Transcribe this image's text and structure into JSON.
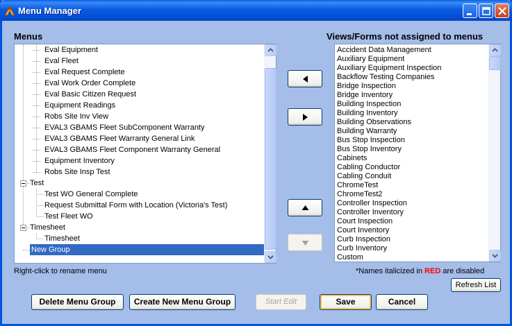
{
  "window": {
    "title": "Menu Manager",
    "controls": [
      "minimize-icon",
      "maximize-icon",
      "close-icon"
    ]
  },
  "menus": {
    "heading": "Menus",
    "tree": [
      {
        "label": "Eval Equipment",
        "level": 2
      },
      {
        "label": "Eval Fleet",
        "level": 2
      },
      {
        "label": "Eval Request Complete",
        "level": 2
      },
      {
        "label": "Eval Work Order Complete",
        "level": 2
      },
      {
        "label": "Eval Basic Citizen Request",
        "level": 2
      },
      {
        "label": "Equipment Readings",
        "level": 2
      },
      {
        "label": "Robs Site Inv View",
        "level": 2
      },
      {
        "label": "EVAL3 GBAMS Fleet SubComponent Warranty",
        "level": 2
      },
      {
        "label": "EVAL3 GBAMS Fleet Warranty General Link",
        "level": 2
      },
      {
        "label": "EVAL3 GBAMS Fleet Component Warranty General",
        "level": 2
      },
      {
        "label": "Equipment Inventory",
        "level": 2
      },
      {
        "label": "Robs Site Insp Test",
        "level": 2
      },
      {
        "label": "Test",
        "level": 1,
        "expanded": true
      },
      {
        "label": "Test WO General Complete",
        "level": 2
      },
      {
        "label": "Request Submittal Form with Location (Victoria's Test)",
        "level": 2
      },
      {
        "label": "Test Fleet WO",
        "level": 2
      },
      {
        "label": "Timesheet",
        "level": 1,
        "expanded": true
      },
      {
        "label": "Timesheet",
        "level": 2
      },
      {
        "label": "New Group",
        "level": 1,
        "selected": true
      }
    ],
    "hint": "Right-click to rename menu"
  },
  "views": {
    "heading": "Views/Forms not assigned to menus",
    "items": [
      "Accident Data Management",
      "Auxiliary Equipment",
      "Auxiliary Equipment Inspection",
      "Backflow Testing Companies",
      "Bridge Inspection",
      "Bridge Inventory",
      "Building Inspection",
      "Building Inventory",
      "Building Observations",
      "Building Warranty",
      "Bus Stop Inspection",
      "Bus Stop Inventory",
      "Cabinets",
      "Cabling Conductor",
      "Cabling Conduit",
      "ChromeTest",
      "ChromeTest2",
      "Controller Inspection",
      "Controller Inventory",
      "Court Inspection",
      "Court Inventory",
      "Curb Inspection",
      "Curb Inventory",
      "Custom"
    ],
    "note_prefix": "*Names italicized in ",
    "note_red": "RED",
    "note_suffix": " are disabled",
    "note_red_color": "#ff0000"
  },
  "buttons": {
    "move_left": "left-arrow-icon",
    "move_right": "right-arrow-icon",
    "move_up": "up-arrow-icon",
    "move_down": "down-arrow-icon",
    "refresh": "Refresh List",
    "delete_group": "Delete Menu Group",
    "create_group": "Create New Menu Group",
    "start_edit": "Start Edit",
    "save": "Save",
    "cancel": "Cancel"
  }
}
